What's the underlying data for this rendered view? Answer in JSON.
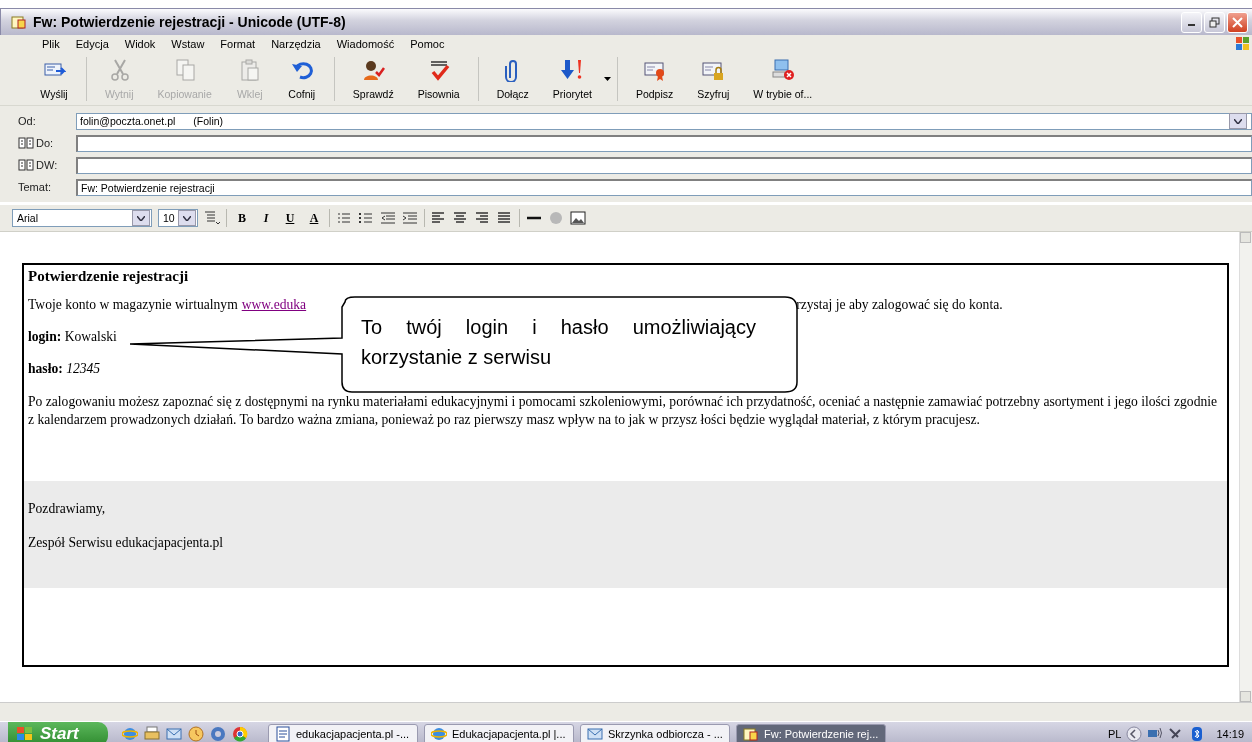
{
  "window": {
    "title": "Fw: Potwierdzenie rejestracji - Unicode (UTF-8)"
  },
  "menu": [
    "Plik",
    "Edycja",
    "Widok",
    "Wstaw",
    "Format",
    "Narzędzia",
    "Wiadomość",
    "Pomoc"
  ],
  "toolbar": [
    [
      {
        "kind": "button",
        "label": "Wyślij",
        "disabled": false
      }
    ],
    [
      {
        "kind": "button",
        "label": "Wytnij",
        "disabled": true
      },
      {
        "kind": "button",
        "label": "Kopiowanie",
        "disabled": true
      },
      {
        "kind": "button",
        "label": "Wklej",
        "disabled": true
      },
      {
        "kind": "button",
        "label": "Cofnij",
        "disabled": false
      }
    ],
    [
      {
        "kind": "button",
        "label": "Sprawdź",
        "disabled": false
      },
      {
        "kind": "button",
        "label": "Pisownia",
        "disabled": false
      }
    ],
    [
      {
        "kind": "button",
        "label": "Dołącz",
        "disabled": false
      },
      {
        "kind": "dropdown",
        "label": "Priorytet",
        "disabled": false
      }
    ],
    [
      {
        "kind": "button",
        "label": "Podpisz",
        "disabled": false
      },
      {
        "kind": "button",
        "label": "Szyfruj",
        "disabled": false
      },
      {
        "kind": "button",
        "label": "W trybie of...",
        "disabled": false
      }
    ]
  ],
  "fields": [
    {
      "kind": "select",
      "label": "Od:",
      "value": "folin@poczta.onet.pl",
      "display_name": "(Folin)"
    },
    {
      "kind": "address",
      "label": "Do:"
    },
    {
      "kind": "address",
      "label": "DW:"
    },
    {
      "kind": "text",
      "label": "Temat:",
      "value": "Fw: Potwierdzenie rejestracji"
    }
  ],
  "format_bar": {
    "font": "Arial",
    "size": "10",
    "style_buttons": [
      "B",
      "I",
      "U",
      "A"
    ]
  },
  "message": {
    "heading": "Potwierdzenie rejestracji",
    "intro_start": "Twoje konto w magazynie wirtualnym",
    "link": "www.eduka",
    "intro_end": "rzystaj je aby zalogować się do konta.",
    "login_label": "login:",
    "login": "Kowalski",
    "password_label": "hasło:",
    "password": "12345",
    "paragraph": "Po zalogowaniu możesz zapoznać się z dostępnymi na rynku materiałami edukacyjnymi i pomocami szkoleniowymi, porównać ich przydatność, oceniać a następnie zamawiać potrzebny asortyment i jego ilości zgodnie z kalendarzem prowadzonych działań. To bardzo ważna zmiana, ponieważ po raz pierwszy masz wpływ na to jak w przysz łości będzie wyglądał materiał, z którym pracujesz.",
    "greeting": "Pozdrawiamy,",
    "signature": "Zespół Serwisu edukacjapacjenta.pl"
  },
  "callout": {
    "text": "To twój login i hasło umożliwiający korzystanie z serwisu"
  },
  "taskbar": {
    "start": "Start",
    "tasks": [
      {
        "label": "edukacjapacjenta.pl -...",
        "selected": false
      },
      {
        "label": "Edukacjapacjenta.pl |...",
        "selected": false
      },
      {
        "label": "Skrzynka odbiorcza - ...",
        "selected": false
      },
      {
        "label": "Fw: Potwierdzenie rej...",
        "selected": true
      }
    ],
    "language": "PL",
    "clock": "14:19"
  }
}
